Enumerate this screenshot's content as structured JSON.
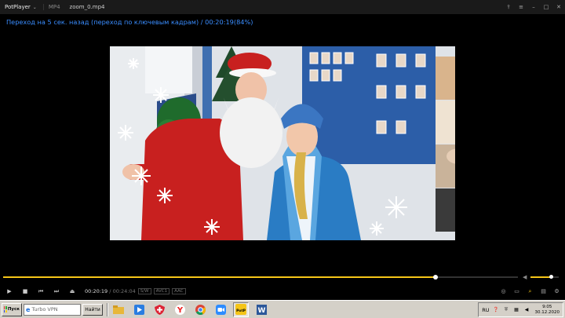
{
  "titlebar": {
    "app_name": "PotPlayer",
    "format": "MP4",
    "filename": "zoom_0.mp4",
    "controls": [
      "pin-icon",
      "menu-icon",
      "minimize-icon",
      "maximize-icon",
      "close-icon"
    ]
  },
  "osd": {
    "message": "Переход на 5  сек. назад (переход по ключевым кадрам) / 00:20:19(84%)"
  },
  "playback": {
    "progress": 0.84,
    "volume": 0.72,
    "current_time": "00:20:19",
    "separator": "/",
    "duration": "00:24:04",
    "badges": [
      "S/W",
      "AVC1",
      "AAC"
    ]
  },
  "controls": {
    "buttons": [
      "play-icon",
      "stop-icon",
      "previous-icon",
      "next-icon",
      "eject-icon"
    ],
    "right_icons": [
      "3d-icon",
      "subtitle-icon",
      "search-icon",
      "playlist-icon",
      "settings-icon"
    ]
  },
  "taskbar": {
    "start_label": "Пуск",
    "search_placeholder": "Turbo VPN",
    "search_button": "Найти",
    "apps": [
      "file-explorer-icon",
      "media-player-icon",
      "antivirus-icon",
      "yandex-browser-icon",
      "chrome-icon",
      "zoom-icon",
      "potplayer-icon",
      "word-icon"
    ],
    "potplayer_label": "PotP",
    "word_label": "W",
    "tray": {
      "language": "RU",
      "time": "9:05",
      "date": "30.12.2020"
    }
  },
  "colors": {
    "osd_text": "#3a8dff",
    "accent": "#f5c518",
    "taskbar": "#d4d0c8"
  }
}
